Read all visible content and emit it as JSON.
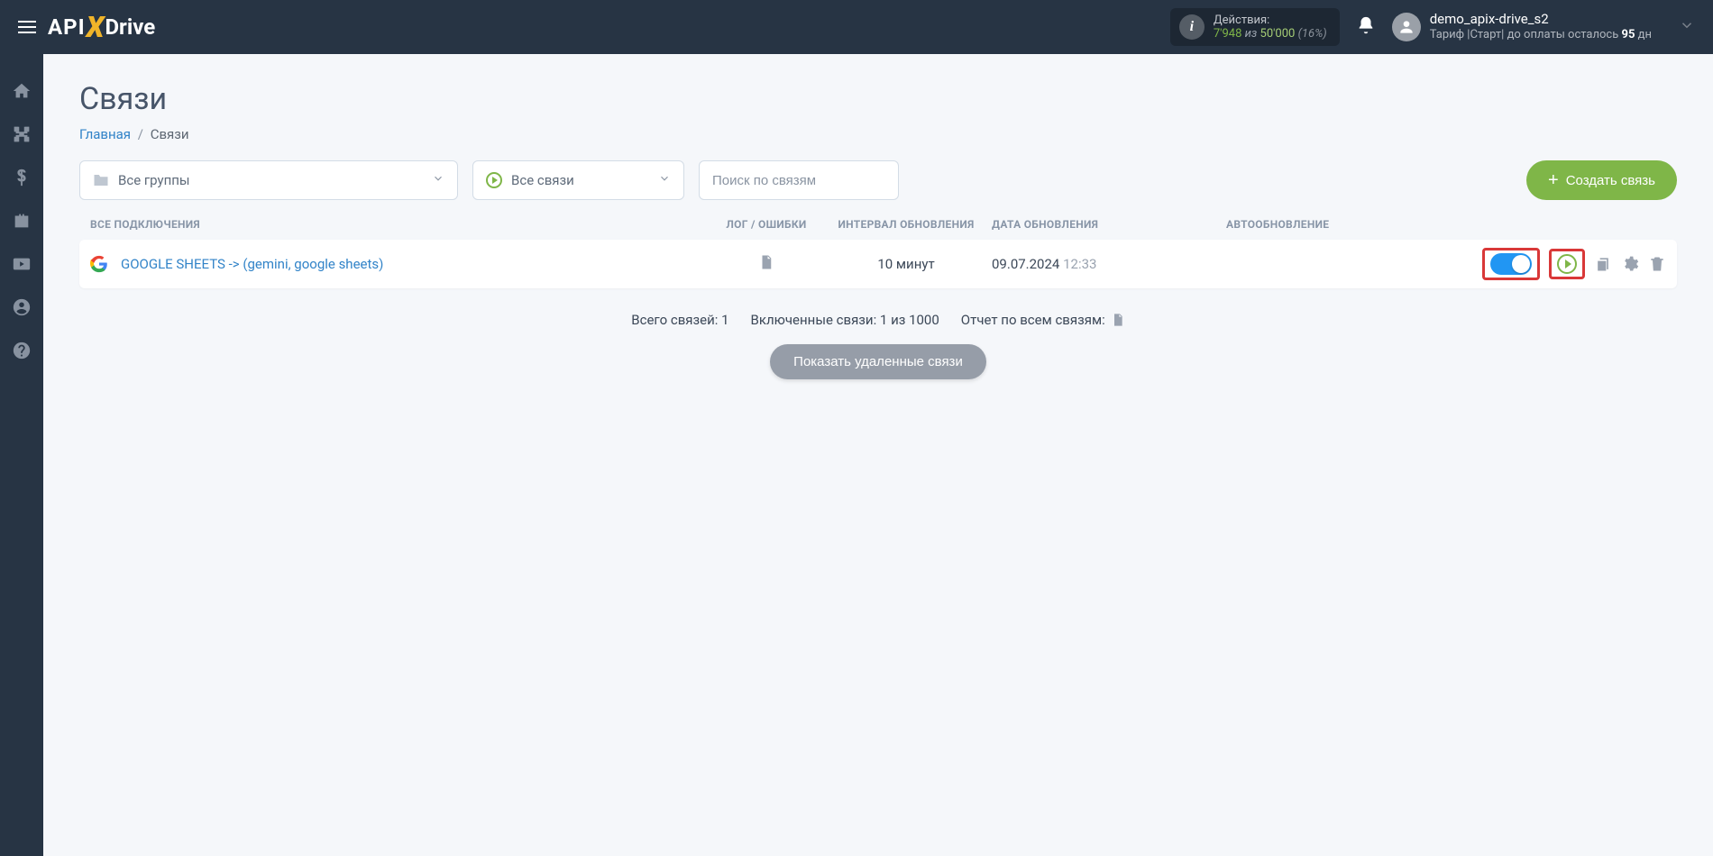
{
  "header": {
    "logo": {
      "p1": "API",
      "p2": "X",
      "p3": "Drive"
    },
    "actions": {
      "label": "Действия:",
      "used": "7'948",
      "of_word": "из",
      "limit": "50'000",
      "percent": "(16%)"
    },
    "user": {
      "name": "demo_apix-drive_s2",
      "tariff_prefix": "Тариф |Старт| до оплаты осталось ",
      "days": "95",
      "days_suffix": " дн"
    }
  },
  "page": {
    "title": "Связи",
    "breadcrumb": {
      "home": "Главная",
      "current": "Связи"
    }
  },
  "filters": {
    "groups_label": "Все группы",
    "connections_label": "Все связи",
    "search_placeholder": "Поиск по связям",
    "create_label": "Создать связь"
  },
  "columns": {
    "name": "ВСЕ ПОДКЛЮЧЕНИЯ",
    "log": "ЛОГ / ОШИБКИ",
    "interval": "ИНТЕРВАЛ ОБНОВЛЕНИЯ",
    "date": "ДАТА ОБНОВЛЕНИЯ",
    "auto": "АВТООБНОВЛЕНИЕ"
  },
  "row": {
    "name": "GOOGLE SHEETS -> (gemini, google sheets)",
    "interval": "10 минут",
    "date": "09.07.2024",
    "time": "12:33"
  },
  "summary": {
    "total": "Всего связей: 1",
    "enabled": "Включенные связи: 1 из 1000",
    "report": "Отчет по всем связям:"
  },
  "show_deleted": "Показать удаленные связи"
}
